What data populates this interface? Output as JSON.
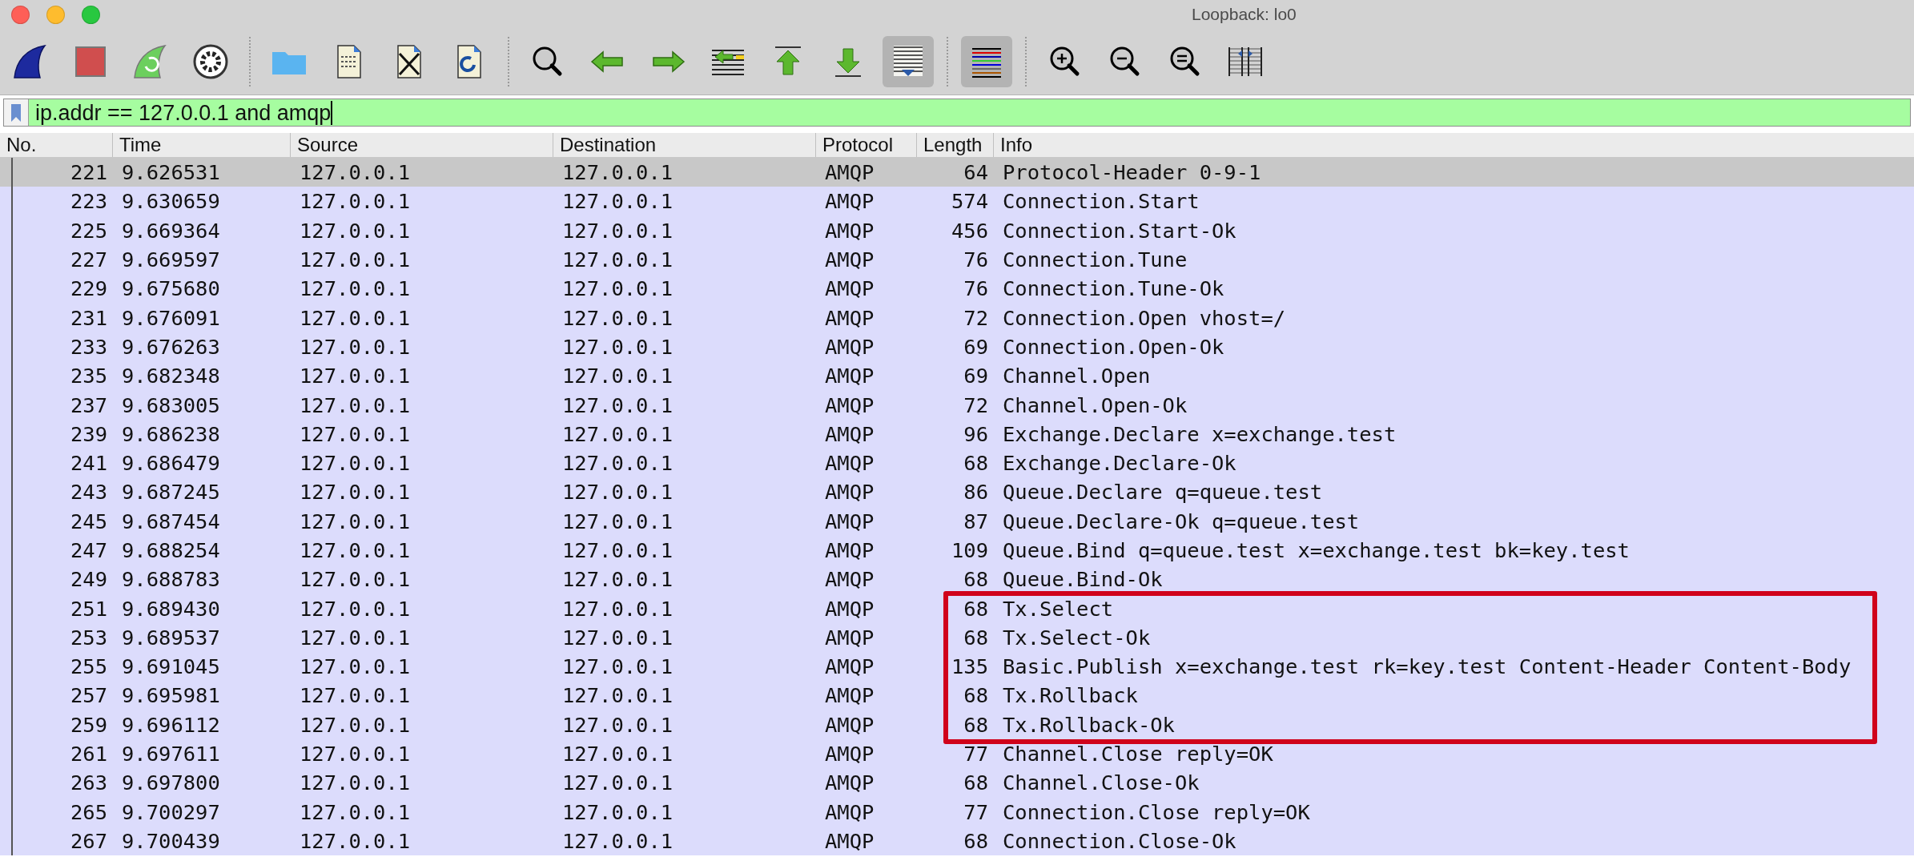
{
  "window": {
    "title": "Loopback: lo0"
  },
  "toolbar": [
    [
      {
        "active": false
      },
      {
        "active": false
      },
      {
        "active": false
      },
      {
        "active": false
      }
    ],
    [
      {
        "active": false
      },
      {
        "active": false
      },
      {
        "active": false
      },
      {
        "active": false
      }
    ],
    [
      {
        "active": false
      },
      {
        "active": false
      },
      {
        "active": false
      },
      {
        "active": false
      },
      {
        "active": false
      },
      {
        "active": false
      },
      {
        "active": true
      }
    ],
    [
      {
        "active": true
      }
    ],
    [
      {
        "active": false
      },
      {
        "active": false
      },
      {
        "active": false
      },
      {
        "active": false
      }
    ]
  ],
  "filter": {
    "value": "ip.addr == 127.0.0.1 and amqp"
  },
  "table": {
    "columns": [
      "No.",
      "Time",
      "Source",
      "Destination",
      "Protocol",
      "Length",
      "Info"
    ],
    "rows": [
      {
        "no": "221",
        "time": "9.626531",
        "source": "127.0.0.1",
        "destination": "127.0.0.1",
        "protocol": "AMQP",
        "length": "64",
        "info": "Protocol-Header 0-9-1",
        "selected": true,
        "boxed": false
      },
      {
        "no": "223",
        "time": "9.630659",
        "source": "127.0.0.1",
        "destination": "127.0.0.1",
        "protocol": "AMQP",
        "length": "574",
        "info": "Connection.Start",
        "selected": false,
        "boxed": false
      },
      {
        "no": "225",
        "time": "9.669364",
        "source": "127.0.0.1",
        "destination": "127.0.0.1",
        "protocol": "AMQP",
        "length": "456",
        "info": "Connection.Start-Ok",
        "selected": false,
        "boxed": false
      },
      {
        "no": "227",
        "time": "9.669597",
        "source": "127.0.0.1",
        "destination": "127.0.0.1",
        "protocol": "AMQP",
        "length": "76",
        "info": "Connection.Tune",
        "selected": false,
        "boxed": false
      },
      {
        "no": "229",
        "time": "9.675680",
        "source": "127.0.0.1",
        "destination": "127.0.0.1",
        "protocol": "AMQP",
        "length": "76",
        "info": "Connection.Tune-Ok",
        "selected": false,
        "boxed": false
      },
      {
        "no": "231",
        "time": "9.676091",
        "source": "127.0.0.1",
        "destination": "127.0.0.1",
        "protocol": "AMQP",
        "length": "72",
        "info": "Connection.Open vhost=/",
        "selected": false,
        "boxed": false
      },
      {
        "no": "233",
        "time": "9.676263",
        "source": "127.0.0.1",
        "destination": "127.0.0.1",
        "protocol": "AMQP",
        "length": "69",
        "info": "Connection.Open-Ok",
        "selected": false,
        "boxed": false
      },
      {
        "no": "235",
        "time": "9.682348",
        "source": "127.0.0.1",
        "destination": "127.0.0.1",
        "protocol": "AMQP",
        "length": "69",
        "info": "Channel.Open",
        "selected": false,
        "boxed": false
      },
      {
        "no": "237",
        "time": "9.683005",
        "source": "127.0.0.1",
        "destination": "127.0.0.1",
        "protocol": "AMQP",
        "length": "72",
        "info": "Channel.Open-Ok",
        "selected": false,
        "boxed": false
      },
      {
        "no": "239",
        "time": "9.686238",
        "source": "127.0.0.1",
        "destination": "127.0.0.1",
        "protocol": "AMQP",
        "length": "96",
        "info": "Exchange.Declare x=exchange.test",
        "selected": false,
        "boxed": false
      },
      {
        "no": "241",
        "time": "9.686479",
        "source": "127.0.0.1",
        "destination": "127.0.0.1",
        "protocol": "AMQP",
        "length": "68",
        "info": "Exchange.Declare-Ok",
        "selected": false,
        "boxed": false
      },
      {
        "no": "243",
        "time": "9.687245",
        "source": "127.0.0.1",
        "destination": "127.0.0.1",
        "protocol": "AMQP",
        "length": "86",
        "info": "Queue.Declare q=queue.test",
        "selected": false,
        "boxed": false
      },
      {
        "no": "245",
        "time": "9.687454",
        "source": "127.0.0.1",
        "destination": "127.0.0.1",
        "protocol": "AMQP",
        "length": "87",
        "info": "Queue.Declare-Ok q=queue.test",
        "selected": false,
        "boxed": false
      },
      {
        "no": "247",
        "time": "9.688254",
        "source": "127.0.0.1",
        "destination": "127.0.0.1",
        "protocol": "AMQP",
        "length": "109",
        "info": "Queue.Bind q=queue.test x=exchange.test bk=key.test",
        "selected": false,
        "boxed": false
      },
      {
        "no": "249",
        "time": "9.688783",
        "source": "127.0.0.1",
        "destination": "127.0.0.1",
        "protocol": "AMQP",
        "length": "68",
        "info": "Queue.Bind-Ok",
        "selected": false,
        "boxed": false
      },
      {
        "no": "251",
        "time": "9.689430",
        "source": "127.0.0.1",
        "destination": "127.0.0.1",
        "protocol": "AMQP",
        "length": "68",
        "info": "Tx.Select",
        "selected": false,
        "boxed": true
      },
      {
        "no": "253",
        "time": "9.689537",
        "source": "127.0.0.1",
        "destination": "127.0.0.1",
        "protocol": "AMQP",
        "length": "68",
        "info": "Tx.Select-Ok",
        "selected": false,
        "boxed": true
      },
      {
        "no": "255",
        "time": "9.691045",
        "source": "127.0.0.1",
        "destination": "127.0.0.1",
        "protocol": "AMQP",
        "length": "135",
        "info": "Basic.Publish x=exchange.test rk=key.test Content-Header Content-Body",
        "selected": false,
        "boxed": true
      },
      {
        "no": "257",
        "time": "9.695981",
        "source": "127.0.0.1",
        "destination": "127.0.0.1",
        "protocol": "AMQP",
        "length": "68",
        "info": "Tx.Rollback",
        "selected": false,
        "boxed": true
      },
      {
        "no": "259",
        "time": "9.696112",
        "source": "127.0.0.1",
        "destination": "127.0.0.1",
        "protocol": "AMQP",
        "length": "68",
        "info": "Tx.Rollback-Ok",
        "selected": false,
        "boxed": true
      },
      {
        "no": "261",
        "time": "9.697611",
        "source": "127.0.0.1",
        "destination": "127.0.0.1",
        "protocol": "AMQP",
        "length": "77",
        "info": "Channel.Close reply=OK",
        "selected": false,
        "boxed": false
      },
      {
        "no": "263",
        "time": "9.697800",
        "source": "127.0.0.1",
        "destination": "127.0.0.1",
        "protocol": "AMQP",
        "length": "68",
        "info": "Channel.Close-Ok",
        "selected": false,
        "boxed": false
      },
      {
        "no": "265",
        "time": "9.700297",
        "source": "127.0.0.1",
        "destination": "127.0.0.1",
        "protocol": "AMQP",
        "length": "77",
        "info": "Connection.Close reply=OK",
        "selected": false,
        "boxed": false
      },
      {
        "no": "267",
        "time": "9.700439",
        "source": "127.0.0.1",
        "destination": "127.0.0.1",
        "protocol": "AMQP",
        "length": "68",
        "info": "Connection.Close-Ok",
        "selected": false,
        "boxed": false
      }
    ]
  }
}
